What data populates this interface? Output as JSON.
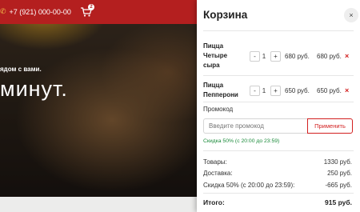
{
  "background": {
    "phone": "+7 (921) 000-00-00",
    "cart_badge": "2",
    "subtitle": "ядом с вами.",
    "hero": "минут."
  },
  "cart": {
    "title": "Корзина",
    "close_symbol": "×",
    "items": [
      {
        "name_lines": [
          "Пицца",
          "Четыре",
          "сыра"
        ],
        "qty": "1",
        "unit_price": "680 руб.",
        "total": "680 руб."
      },
      {
        "name_lines": [
          "Пицца",
          "Пепперони"
        ],
        "qty": "1",
        "unit_price": "650 руб.",
        "total": "650 руб."
      }
    ],
    "minus": "-",
    "plus": "+",
    "remove_symbol": "×",
    "promo": {
      "label": "Промокод",
      "placeholder": "Введите промокод",
      "button": "Применить",
      "note": "Скидка 50% (с 20:00 до 23:59)"
    },
    "summary": [
      {
        "label": "Товары:",
        "value": "1330 руб."
      },
      {
        "label": "Доставка:",
        "value": "250 руб."
      },
      {
        "label": "Скидка 50% (с 20:00 до 23:59):",
        "value": "-665 руб."
      }
    ],
    "total": {
      "label": "Итого:",
      "value": "915 руб."
    }
  },
  "colors": {
    "accent": "#d21f1f",
    "topbar": "#b41f1f",
    "promo_note": "#1a8a3a"
  }
}
